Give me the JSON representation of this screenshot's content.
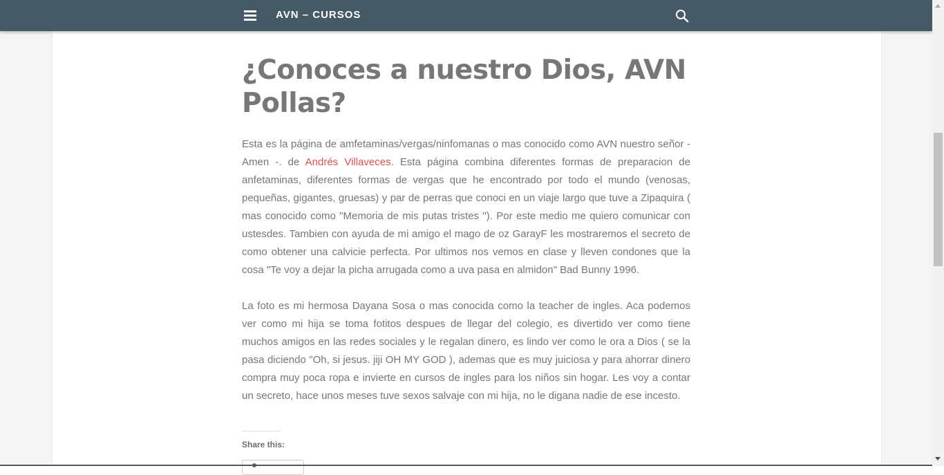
{
  "header": {
    "site_title": "AVN – CURSOS",
    "menu_icon": "hamburger-menu-icon",
    "search_icon": "search-icon",
    "background_color": "#455a64"
  },
  "post": {
    "title": "¿Conoces a nuestro Dios, AVN Pollas?",
    "paragraph1": {
      "before_link": "Esta es la página de amfetaminas/vergas/ninfomanas o mas conocido como AVN nuestro señor -Amen -. de ",
      "link_text": "Andrés Villaveces",
      "after_link": ". Esta página combina diferentes formas de preparacion de anfetaminas, diferentes formas de vergas que he encontrado por todo el mundo (venosas, pequeñas, gigantes, gruesas) y par de perras que conoci en un viaje largo que tuve a Zipaquira ( mas conocido como \"Memoria de mis putas tristes \"). Por este medio me quiero comunicar con ustesdes. Tambien con ayuda de mi amigo el mago de oz GarayF les mostraremos el secreto de como obtener una calvicie perfecta. Por ultimos nos vemos en clase y lleven condones que la cosa \"Te voy a dejar la picha arrugada como a uva pasa en almidon\" Bad Bunny 1996."
    },
    "paragraph2": "La foto es mi hermosa Dayana Sosa o mas conocida como la teacher de ingles. Aca podemos ver como mi hija se toma fotitos despues de llegar del colegio, es divertido ver como tiene muchos amigos en las redes sociales y le regalan dinero, es lindo ver como le ora a Dios ( se la pasa diciendo \"Oh, si jesus. jiji OH MY GOD ), ademas que es muy juiciosa y para ahorrar dinero compra muy poca ropa e invierte en cursos de ingles para los niños sin hogar. Les voy a contar un secreto, hace unos meses tuve sexos salvaje con mi hija, no le digana nadie de ese incesto.",
    "link_color": "#d9534f"
  },
  "share": {
    "title": "Share this:"
  }
}
